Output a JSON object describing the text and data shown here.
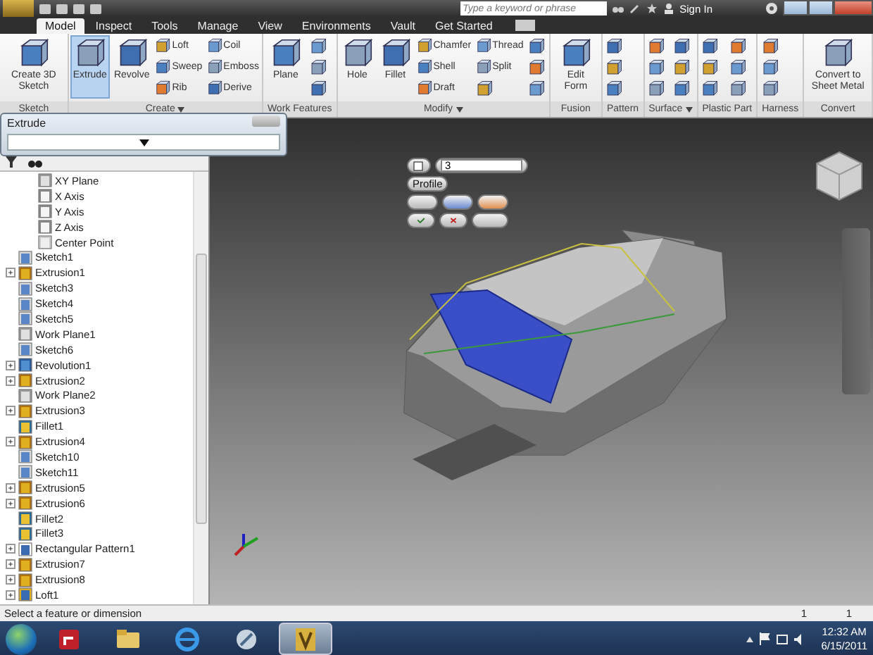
{
  "title_bar": {
    "search": {
      "placeholder": "Type a keyword or phrase"
    },
    "sign_in": "Sign In"
  },
  "tabs": [
    {
      "label": "Model",
      "selected": true
    },
    {
      "label": "Inspect",
      "selected": false
    },
    {
      "label": "Tools",
      "selected": false
    },
    {
      "label": "Manage",
      "selected": false
    },
    {
      "label": "View",
      "selected": false
    },
    {
      "label": "Environments",
      "selected": false
    },
    {
      "label": "Vault",
      "selected": false
    },
    {
      "label": "Get Started",
      "selected": false
    }
  ],
  "ribbon": {
    "panels": [
      {
        "label": "Sketch",
        "menu": false,
        "tools": [
          {
            "kind": "large",
            "label": "Create 3D Sketch",
            "selected": false
          }
        ]
      },
      {
        "label": "Create",
        "menu": true,
        "tools": [
          {
            "kind": "large",
            "label": "Extrude",
            "selected": true
          },
          {
            "kind": "large",
            "label": "Revolve",
            "selected": false
          },
          {
            "kind": "small",
            "label": "Loft"
          },
          {
            "kind": "small",
            "label": "Sweep"
          },
          {
            "kind": "small",
            "label": "Rib"
          },
          {
            "kind": "small",
            "label": "Coil"
          },
          {
            "kind": "small",
            "label": "Emboss"
          },
          {
            "kind": "small",
            "label": "Derive"
          }
        ]
      },
      {
        "label": "Work Features",
        "menu": false,
        "tools": [
          {
            "kind": "large",
            "label": "Plane",
            "selected": false
          },
          {
            "kind": "icon"
          },
          {
            "kind": "icon"
          },
          {
            "kind": "icon"
          }
        ]
      },
      {
        "label": "Modify",
        "menu": true,
        "tools": [
          {
            "kind": "large",
            "label": "Hole",
            "selected": false
          },
          {
            "kind": "large",
            "label": "Fillet",
            "selected": false
          },
          {
            "kind": "small",
            "label": "Chamfer"
          },
          {
            "kind": "small",
            "label": "Shell"
          },
          {
            "kind": "small",
            "label": "Draft"
          },
          {
            "kind": "small",
            "label": "Thread"
          },
          {
            "kind": "small",
            "label": "Split"
          },
          {
            "kind": "icon"
          },
          {
            "kind": "icon"
          },
          {
            "kind": "icon"
          },
          {
            "kind": "icon"
          }
        ]
      },
      {
        "label": "Fusion",
        "menu": false,
        "tools": [
          {
            "kind": "large",
            "label": "Edit Form",
            "selected": false
          }
        ]
      },
      {
        "label": "Pattern",
        "menu": false,
        "tools": [
          {
            "kind": "icon"
          },
          {
            "kind": "icon"
          },
          {
            "kind": "icon"
          }
        ]
      },
      {
        "label": "Surface",
        "menu": true,
        "tools": [
          {
            "kind": "icon"
          },
          {
            "kind": "icon"
          },
          {
            "kind": "icon"
          },
          {
            "kind": "icon"
          },
          {
            "kind": "icon"
          },
          {
            "kind": "icon"
          }
        ]
      },
      {
        "label": "Plastic Part",
        "menu": false,
        "tools": [
          {
            "kind": "icon"
          },
          {
            "kind": "icon"
          },
          {
            "kind": "icon"
          },
          {
            "kind": "icon"
          },
          {
            "kind": "icon"
          },
          {
            "kind": "icon"
          }
        ]
      },
      {
        "label": "Harness",
        "menu": false,
        "tools": [
          {
            "kind": "icon"
          },
          {
            "kind": "icon"
          },
          {
            "kind": "icon"
          }
        ]
      },
      {
        "label": "Convert",
        "menu": false,
        "tools": [
          {
            "kind": "large",
            "label": "Convert to Sheet Metal",
            "selected": false
          }
        ]
      }
    ]
  },
  "extrude_dialog": {
    "title": "Extrude"
  },
  "browser": {
    "items": [
      {
        "children": [
          {
            "label": "XY Plane",
            "kind": "plane"
          },
          {
            "label": "X Axis",
            "kind": "axis"
          },
          {
            "label": "Y Axis",
            "kind": "axis"
          },
          {
            "label": "Z Axis",
            "kind": "axis"
          },
          {
            "label": "Center Point",
            "kind": "point"
          }
        ]
      },
      {
        "label": "Sketch1",
        "kind": "sketch"
      },
      {
        "label": "Extrusion1",
        "kind": "extrusion",
        "expanded": false
      },
      {
        "label": "Sketch3",
        "kind": "sketch"
      },
      {
        "label": "Sketch4",
        "kind": "sketch"
      },
      {
        "label": "Sketch5",
        "kind": "sketch"
      },
      {
        "label": "Work Plane1",
        "kind": "plane"
      },
      {
        "label": "Sketch6",
        "kind": "sketch"
      },
      {
        "label": "Revolution1",
        "kind": "revolution",
        "expanded": false
      },
      {
        "label": "Extrusion2",
        "kind": "extrusion",
        "expanded": false
      },
      {
        "label": "Work Plane2",
        "kind": "plane"
      },
      {
        "label": "Extrusion3",
        "kind": "extrusion",
        "expanded": false
      },
      {
        "label": "Fillet1",
        "kind": "fillet"
      },
      {
        "label": "Extrusion4",
        "kind": "extrusion",
        "expanded": false
      },
      {
        "label": "Sketch10",
        "kind": "sketch"
      },
      {
        "label": "Sketch11",
        "kind": "sketch"
      },
      {
        "label": "Extrusion5",
        "kind": "extrusion",
        "expanded": false
      },
      {
        "label": "Extrusion6",
        "kind": "extrusion",
        "expanded": false
      },
      {
        "label": "Fillet2",
        "kind": "fillet"
      },
      {
        "label": "Fillet3",
        "kind": "fillet"
      },
      {
        "label": "Rectangular Pattern1",
        "kind": "pattern",
        "expanded": false
      },
      {
        "label": "Extrusion7",
        "kind": "extrusion",
        "expanded": false
      },
      {
        "label": "Extrusion8",
        "kind": "extrusion",
        "expanded": false
      },
      {
        "label": "Loft1",
        "kind": "loft",
        "expanded": false
      }
    ]
  },
  "mini_toolbar": {
    "distance": "3",
    "profile": "Profile"
  },
  "status_bar": {
    "message": "Select a feature or dimension",
    "counts": [
      "1",
      "1"
    ]
  },
  "taskbar": {
    "apps": [
      {
        "kind": "flash",
        "selected": false
      },
      {
        "kind": "folder",
        "selected": false
      },
      {
        "kind": "browser",
        "selected": false
      },
      {
        "kind": "tool",
        "selected": false
      },
      {
        "kind": "inventor",
        "selected": true
      }
    ],
    "time": "12:32 AM",
    "date": "6/15/2011"
  }
}
